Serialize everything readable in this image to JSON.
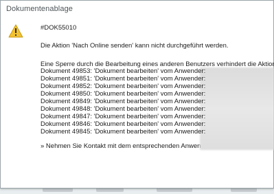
{
  "dialog": {
    "title": "Dokumentenablage",
    "code": "#DOK55010",
    "message": "Die Aktion 'Nach Online senden' kann nicht durchgeführt werden.",
    "lock_intro": "Eine Sperre durch die Bearbeitung eines anderen Benutzers verhindert die Aktion:",
    "documents": [
      "Dokument 49853: 'Dokument bearbeiten' vom Anwender:",
      "Dokument 49851: 'Dokument bearbeiten' vom Anwender:",
      "Dokument 49852: 'Dokument bearbeiten' vom Anwender:",
      "Dokument 49850: 'Dokument bearbeiten' vom Anwender:",
      "Dokument 49849: 'Dokument bearbeiten' vom Anwender:",
      "Dokument 49848: 'Dokument bearbeiten' vom Anwender:",
      "Dokument 49847: 'Dokument bearbeiten' vom Anwender:",
      "Dokument 49846: 'Dokument bearbeiten' vom Anwender:",
      "Dokument 49845: 'Dokument bearbeiten' vom Anwender:"
    ],
    "hint": "» Nehmen Sie Kontakt mit dem entsprechenden Anwender auf.",
    "icon": "warning-icon"
  },
  "colors": {
    "warning_fill": "#f2c230",
    "warning_stroke": "#c99a12",
    "redaction": "#e0e0e0"
  }
}
